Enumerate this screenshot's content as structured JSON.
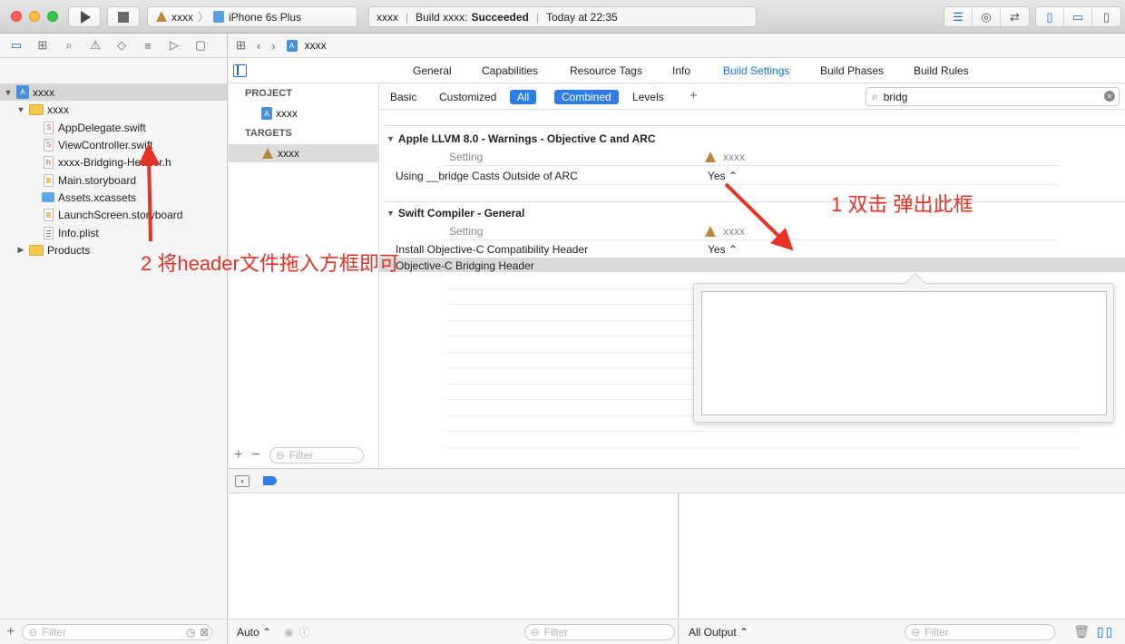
{
  "toolbar": {
    "scheme_target": "xxxx",
    "scheme_sep": "〉",
    "device": "iPhone 6s Plus",
    "status_project": "xxxx",
    "status_build_prefix": "Build xxxx:",
    "status_result": "Succeeded",
    "status_time": "Today at 22:35"
  },
  "navigator": {
    "project_name": "xxxx",
    "group_name": "xxxx",
    "files": [
      "AppDelegate.swift",
      "ViewController.swift",
      "xxxx-Bridging-Header.h",
      "Main.storyboard",
      "Assets.xcassets",
      "LaunchScreen.storyboard",
      "Info.plist"
    ],
    "products": "Products",
    "filter_placeholder": "Filter"
  },
  "jumpbar": {
    "crumb": "xxxx"
  },
  "tabs": [
    "General",
    "Capabilities",
    "Resource Tags",
    "Info",
    "Build Settings",
    "Build Phases",
    "Build Rules"
  ],
  "targets_panel": {
    "project_header": "PROJECT",
    "project_item": "xxxx",
    "targets_header": "TARGETS",
    "target_item": "xxxx",
    "filter_placeholder": "Filter"
  },
  "filterbar": {
    "basic": "Basic",
    "customized": "Customized",
    "all": "All",
    "combined": "Combined",
    "levels": "Levels",
    "search_value": "bridg"
  },
  "sections": [
    {
      "title": "Apple LLVM 8.0 - Warnings - Objective C and ARC",
      "col_setting": "Setting",
      "col_target": "xxxx",
      "rows": [
        {
          "name": "Using __bridge Casts Outside of ARC",
          "value": "Yes ⌃"
        }
      ]
    },
    {
      "title": "Swift Compiler - General",
      "col_setting": "Setting",
      "col_target": "xxxx",
      "rows": [
        {
          "name": "Install Objective-C Compatibility Header",
          "value": "Yes ⌃"
        },
        {
          "name": "Objective-C Bridging Header",
          "value": ""
        }
      ]
    }
  ],
  "debug": {
    "auto": "Auto ⌃",
    "filter_placeholder": "Filter",
    "all_output": "All Output ⌃",
    "filter_placeholder_right": "Filter"
  },
  "annotations": {
    "step1": "1  双击 弹出此框",
    "step2": "2 将header文件拖入方框即可"
  },
  "colors": {
    "accent": "#1a6fe0",
    "annotation": "#e53225"
  }
}
